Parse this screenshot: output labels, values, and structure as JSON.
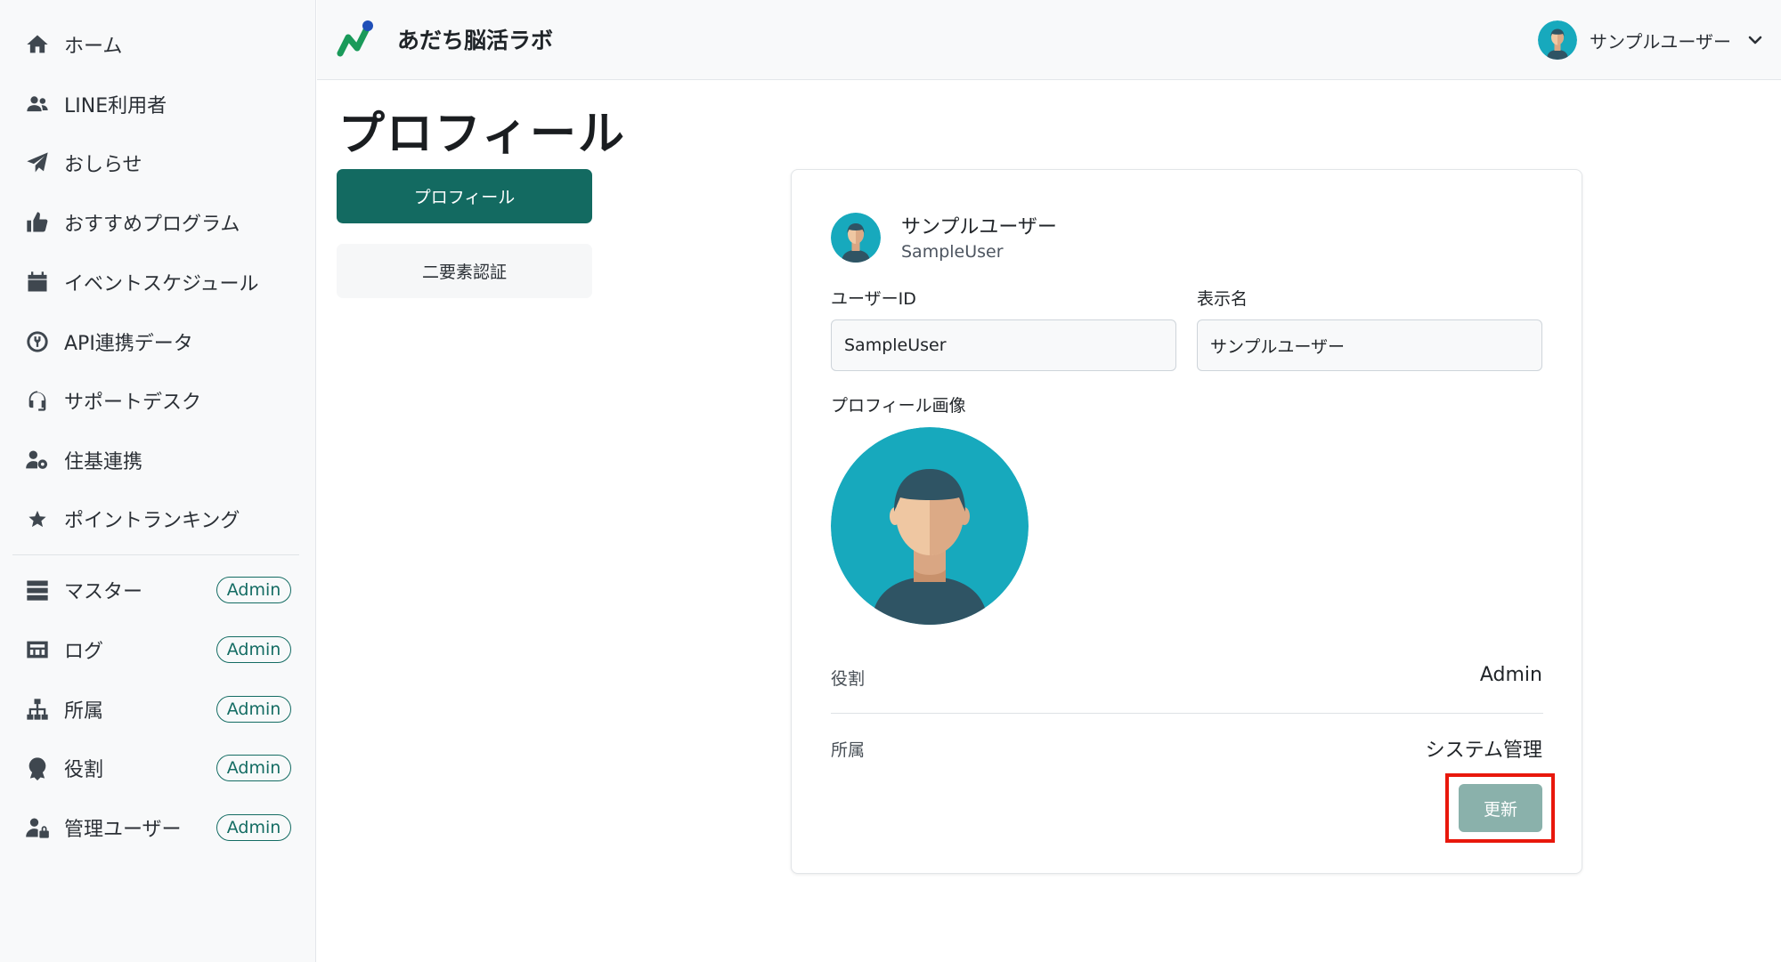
{
  "app": {
    "title": "あだち脳活ラボ",
    "accent_color": "#136a61"
  },
  "sidebar": {
    "items": [
      {
        "label": "ホーム",
        "icon": "home-icon"
      },
      {
        "label": "LINE利用者",
        "icon": "users-icon"
      },
      {
        "label": "おしらせ",
        "icon": "paper-plane-icon"
      },
      {
        "label": "おすすめプログラム",
        "icon": "thumbs-up-icon"
      },
      {
        "label": "イベントスケジュール",
        "icon": "calendar-icon"
      },
      {
        "label": "API連携データ",
        "icon": "plug-icon"
      },
      {
        "label": "サポートデスク",
        "icon": "headset-icon"
      },
      {
        "label": "住基連携",
        "icon": "user-gear-icon"
      },
      {
        "label": "ポイントランキング",
        "icon": "star-icon"
      }
    ],
    "admin_items": [
      {
        "label": "マスター",
        "badge": "Admin",
        "icon": "server-icon"
      },
      {
        "label": "ログ",
        "badge": "Admin",
        "icon": "log-icon"
      },
      {
        "label": "所属",
        "badge": "Admin",
        "icon": "sitemap-icon"
      },
      {
        "label": "役割",
        "badge": "Admin",
        "icon": "award-icon"
      },
      {
        "label": "管理ユーザー",
        "badge": "Admin",
        "icon": "user-lock-icon"
      }
    ]
  },
  "header": {
    "user_name": "サンプルユーザー"
  },
  "page": {
    "title": "プロフィール",
    "tabs": [
      {
        "label": "プロフィール",
        "active": true
      },
      {
        "label": "二要素認証",
        "active": false
      }
    ]
  },
  "profile": {
    "display_name": "サンプルユーザー",
    "user_id": "SampleUser",
    "user_id_label": "ユーザーID",
    "user_id_value": "SampleUser",
    "display_name_label": "表示名",
    "display_name_value": "サンプルユーザー",
    "image_label": "プロフィール画像",
    "role_label": "役割",
    "role_value": "Admin",
    "affiliation_label": "所属",
    "affiliation_value": "システム管理",
    "update_button": "更新"
  }
}
